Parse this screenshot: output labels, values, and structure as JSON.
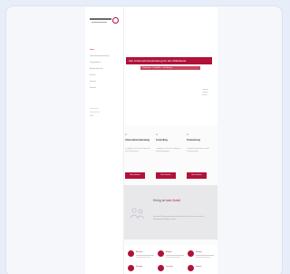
{
  "sidebar": {
    "nav": [
      "Home",
      "Unternehmensberatung",
      "Kompetenzen",
      "Ansprechpartner",
      "Service",
      "Karriere",
      "Kontakt"
    ],
    "footer": [
      "Impressum",
      "Datenschutz",
      "AGB"
    ]
  },
  "hero": {
    "banner": "Ihre Unternehmensberatung für den Mittelstand",
    "subbanner": "Kompetent · Persönlich · Zuverlässig",
    "note": [
      "Kontakt",
      "Telefon",
      "E-Mail"
    ]
  },
  "offers": [
    {
      "num": "01",
      "title": "Unternehmensberatung",
      "body": "Wir begleiten Sie bei allen Fragen rund um Ihr Unternehmen.",
      "button": "Mehr erfahren"
    },
    {
      "num": "02",
      "title": "Controlling",
      "body": "Transparente Zahlen als Grundlage für Ihre Entscheidungen.",
      "button": "Mehr erfahren"
    },
    {
      "num": "03",
      "title": "Finanzierung",
      "body": "Wir finden die passende Lösung für Ihre Finanzierung.",
      "button": "Mehr erfahren"
    }
  ],
  "grey": {
    "title_a": "Erfolg ist ",
    "title_b": "kein Zufall",
    "body": "Mit unserer Erfahrung unterstützen wir Sie dabei, Ihre Ziele zu erreichen und Ihr Unternehmen nachhaltig zu stärken."
  },
  "services": [
    "Beratung",
    "Analyse",
    "Planung",
    "Strategie",
    "Coaching",
    "Support"
  ],
  "colors": {
    "accent": "#b0123a",
    "background": "#e7eefa"
  }
}
